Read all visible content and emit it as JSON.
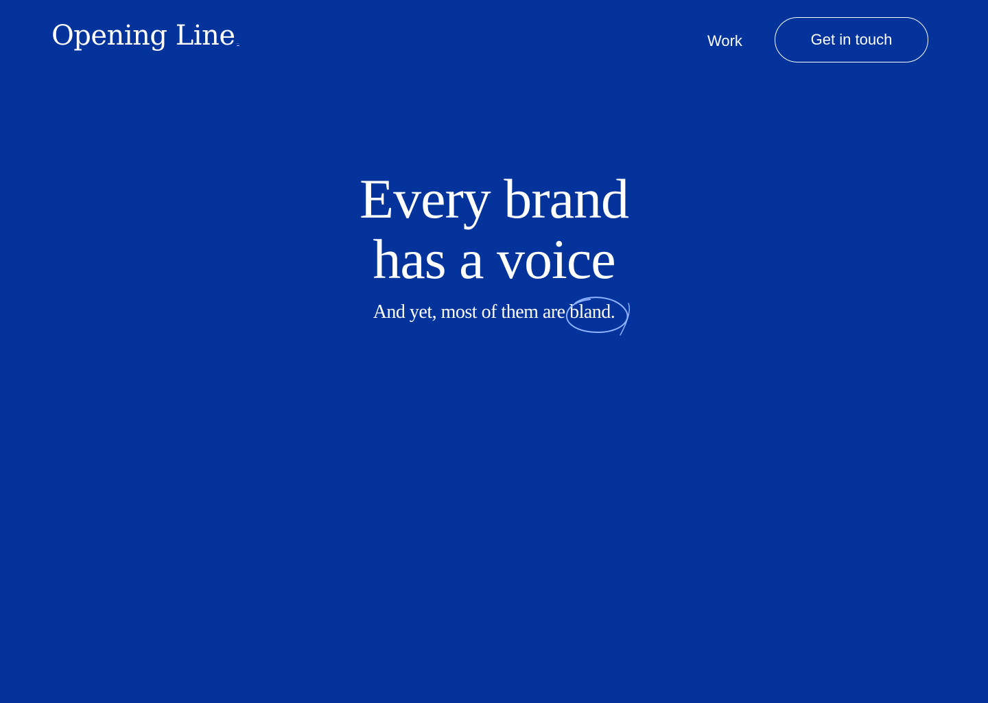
{
  "header": {
    "logo_text": "Opening Line",
    "logo_tagline": "—",
    "nav_work": "Work",
    "cta_label": "Get in touch"
  },
  "hero": {
    "title_line1": "Every brand",
    "title_line2": "has a voice",
    "subtitle_prefix": "And yet, most of them are",
    "subtitle_highlight": "bland."
  },
  "colors": {
    "background": "#03339b",
    "text": "#ffffff",
    "circle_stroke": "#8fb2ff"
  },
  "icons": {
    "circle": "hand-drawn-circle-icon"
  }
}
